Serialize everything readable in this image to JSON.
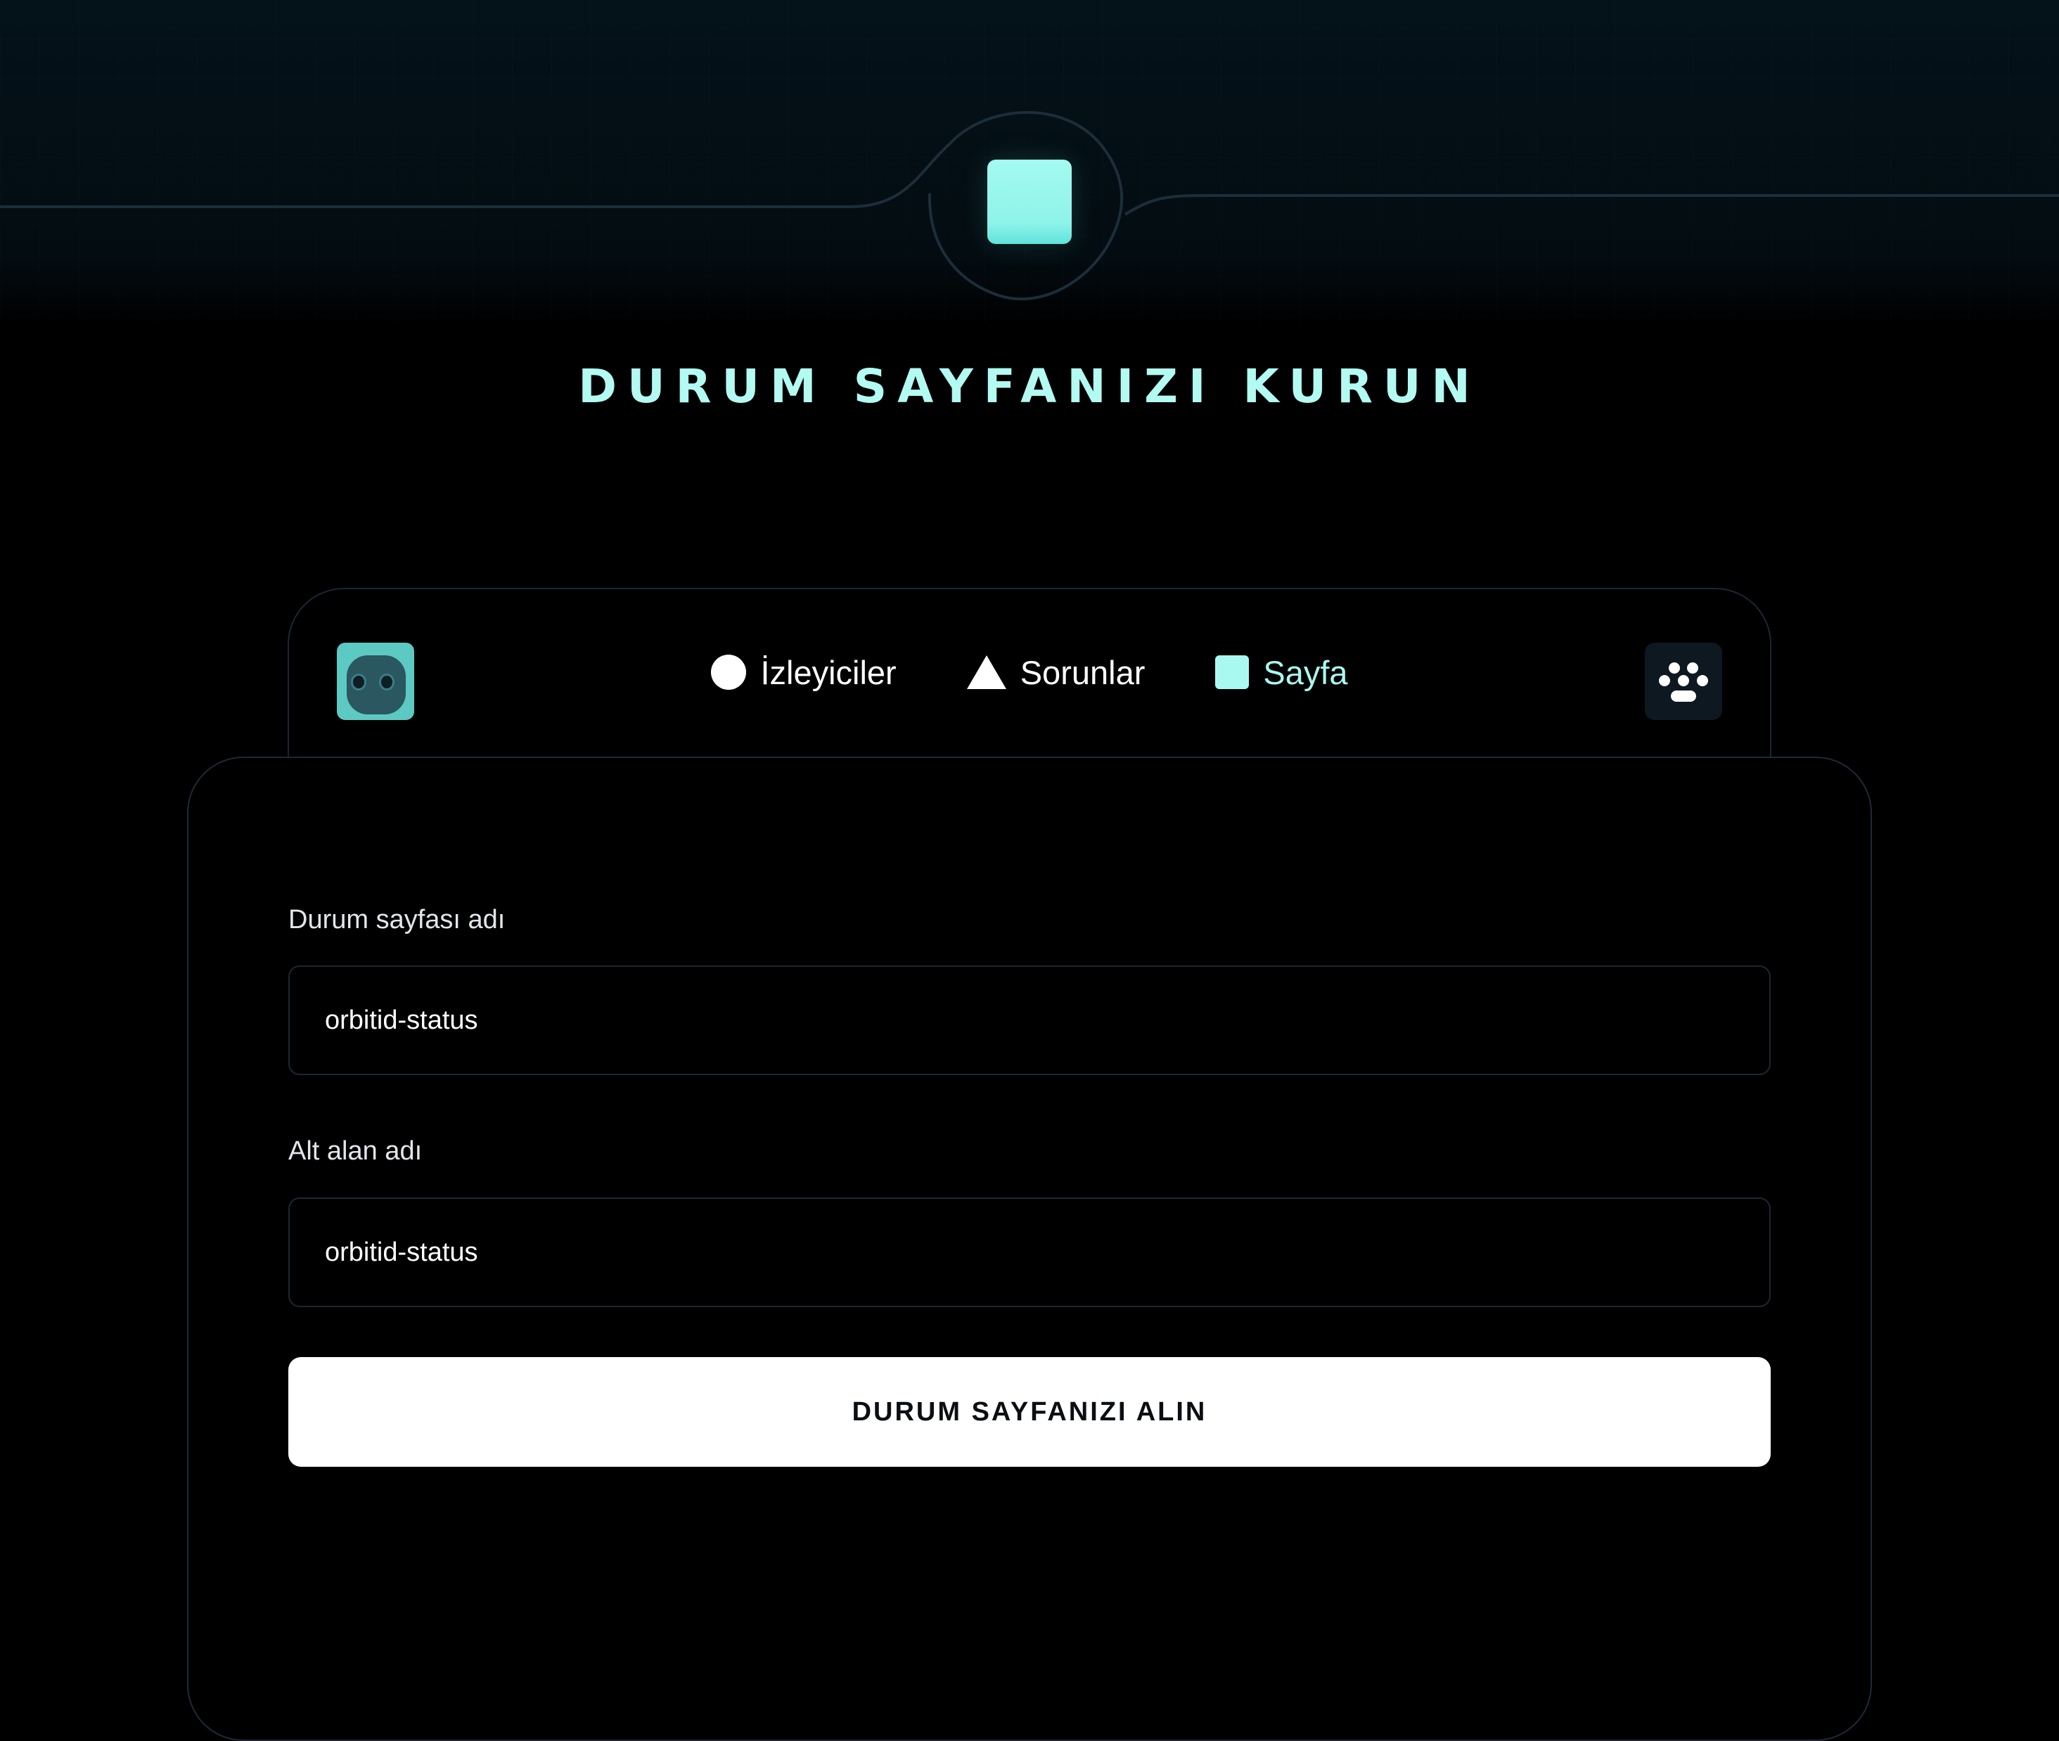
{
  "header": {
    "title": "DURUM SAYFANIZI KURUN"
  },
  "nav": {
    "items": [
      {
        "label": "İzleyiciler",
        "icon": "circle-icon",
        "active": false
      },
      {
        "label": "Sorunlar",
        "icon": "triangle-icon",
        "active": false
      },
      {
        "label": "Sayfa",
        "icon": "square-icon",
        "active": true
      }
    ],
    "right_icon": "paw-icon",
    "avatar_icon": "robot-avatar"
  },
  "form": {
    "page_name_label": "Durum sayfası adı",
    "page_name_value": "orbitid-status",
    "subdomain_label": "Alt alan adı",
    "subdomain_value": "orbitid-status",
    "submit_label": "DURUM SAYFANIZI ALIN"
  },
  "colors": {
    "accent": "#aaf9f0",
    "background": "#000000",
    "border": "#1c2731",
    "button_bg": "#ffffff"
  }
}
